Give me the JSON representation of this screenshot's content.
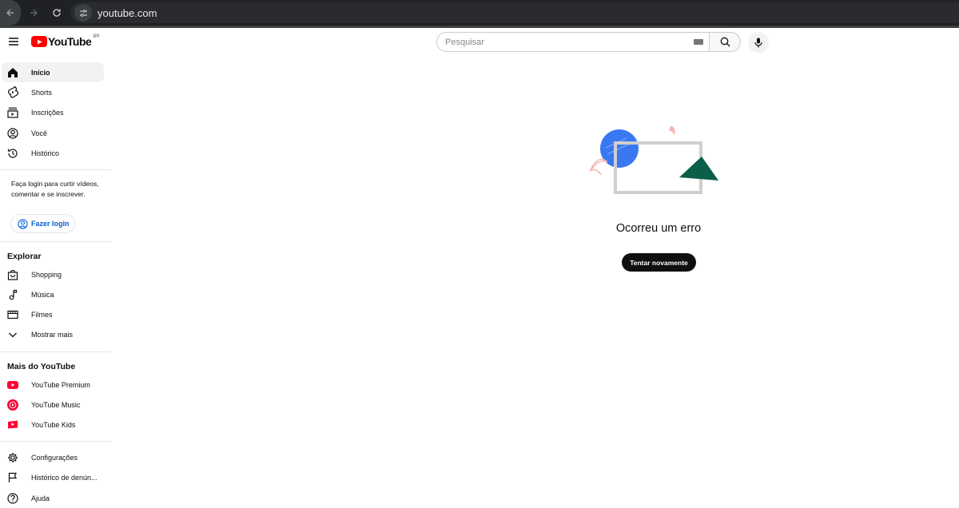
{
  "browser": {
    "url": "youtube.com"
  },
  "masthead": {
    "logo_text": "YouTube",
    "country_code": "BR",
    "search_placeholder": "Pesquisar"
  },
  "sidebar": {
    "main_items": [
      {
        "label": "Início",
        "icon": "home-icon",
        "active": true
      },
      {
        "label": "Shorts",
        "icon": "shorts-icon"
      },
      {
        "label": "Inscrições",
        "icon": "subscriptions-icon"
      },
      {
        "label": "Você",
        "icon": "you-icon"
      },
      {
        "label": "Histórico",
        "icon": "history-icon"
      }
    ],
    "login_prompt": "Faça login para curtir vídeos, comentar e se inscrever.",
    "login_button": "Fazer login",
    "explore_title": "Explorar",
    "explore_items": [
      {
        "label": "Shopping",
        "icon": "shopping-bag-icon"
      },
      {
        "label": "Música",
        "icon": "music-note-icon"
      },
      {
        "label": "Filmes",
        "icon": "film-icon"
      },
      {
        "label": "Mostrar mais",
        "icon": "chevron-down-icon"
      }
    ],
    "more_title": "Mais do YouTube",
    "more_items": [
      {
        "label": "YouTube Premium",
        "icon": "youtube-premium-icon"
      },
      {
        "label": "YouTube Music",
        "icon": "youtube-music-icon"
      },
      {
        "label": "YouTube Kids",
        "icon": "youtube-kids-icon"
      }
    ],
    "footer_items": [
      {
        "label": "Configurações",
        "icon": "gear-icon"
      },
      {
        "label": "Histórico de denún...",
        "icon": "flag-icon"
      },
      {
        "label": "Ajuda",
        "icon": "help-icon"
      }
    ]
  },
  "main": {
    "error_message": "Ocorreu um erro",
    "retry_button": "Tentar novamente"
  },
  "colors": {
    "brand_red": "#ff0000",
    "link_blue": "#065fd4",
    "illustration_blue": "#3a78f2",
    "illustration_green": "#0b5e48",
    "illustration_pink": "#f5b5b0"
  }
}
